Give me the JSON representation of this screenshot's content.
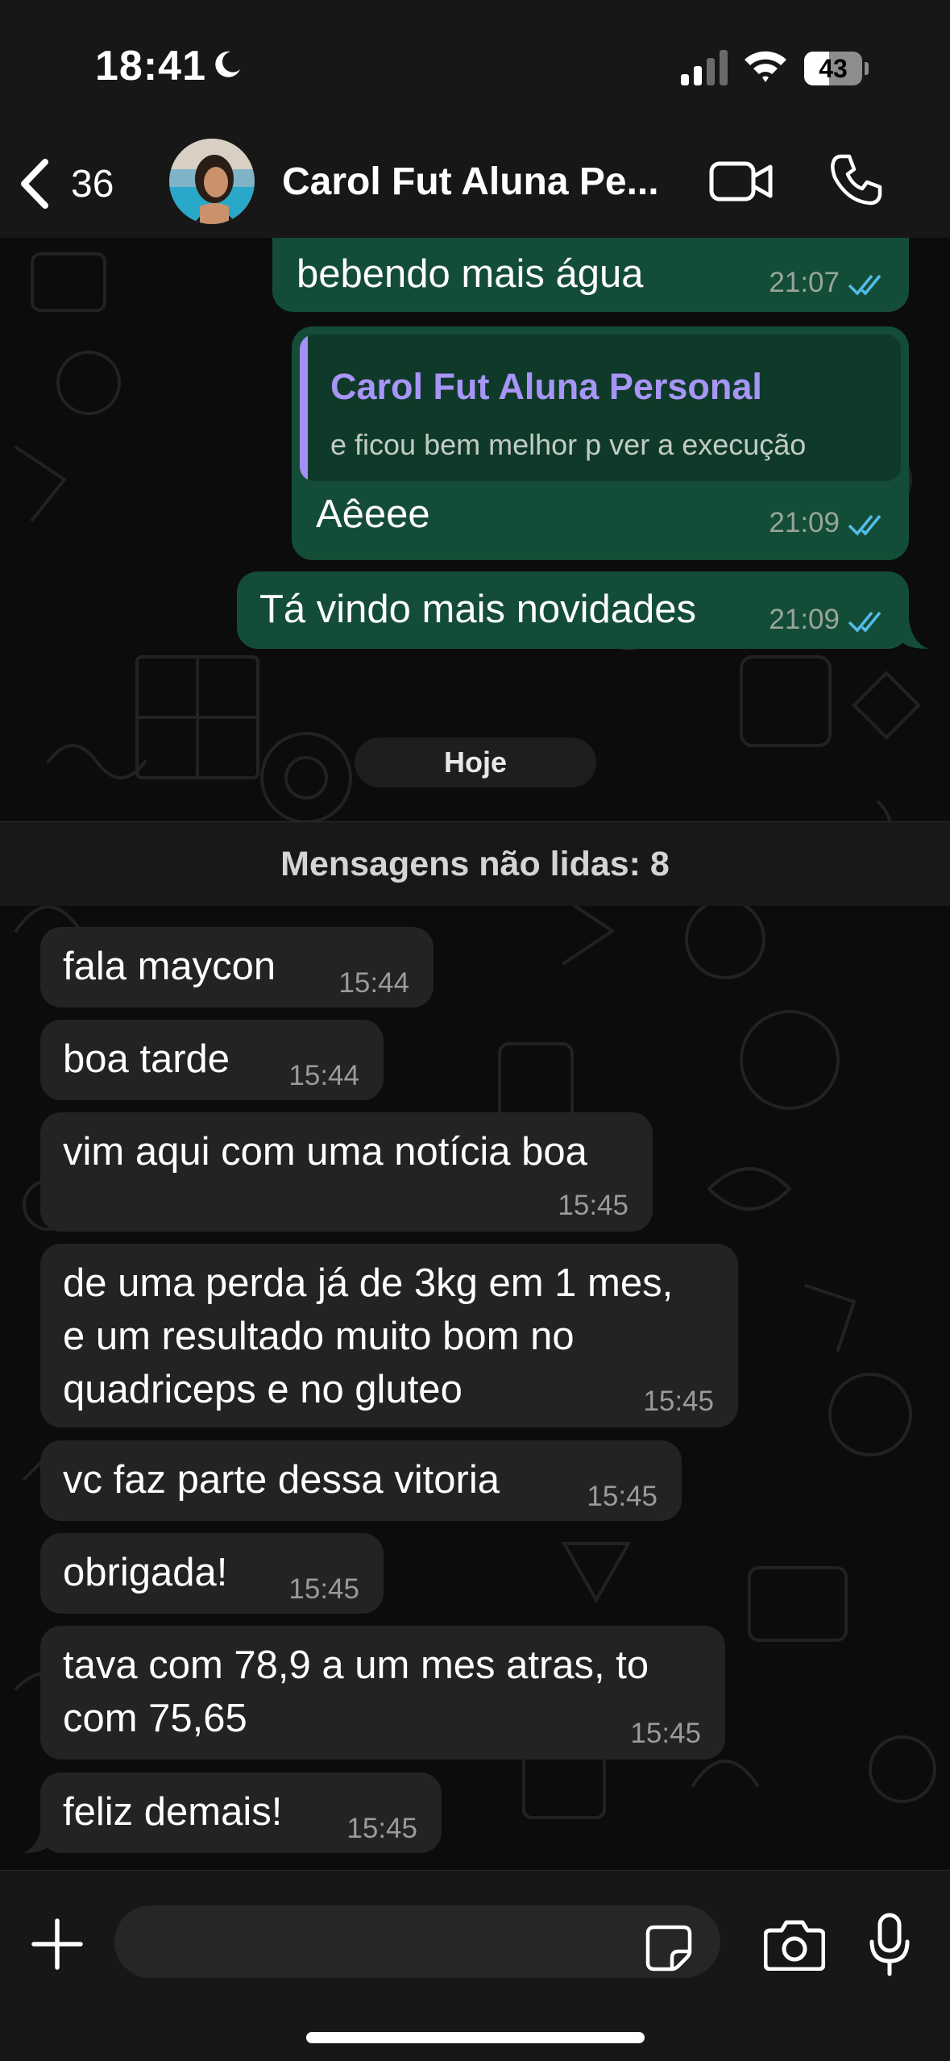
{
  "status_bar": {
    "time": "18:41",
    "battery": "43",
    "battery_level": 0.43
  },
  "header": {
    "back_count": "36",
    "title": "Carol Fut Aluna Pe...",
    "icons": {
      "back": "chevron-left-icon",
      "video": "video-camera-icon",
      "call": "phone-icon"
    }
  },
  "messages_before": [
    {
      "direction": "out",
      "text": "bebendo mais água",
      "time": "21:07",
      "status": "read"
    },
    {
      "direction": "out",
      "quote_author": "Carol Fut Aluna Personal",
      "quote_text": "e ficou bem melhor p ver a execução",
      "text": "Aêeee",
      "time": "21:09",
      "status": "read"
    },
    {
      "direction": "out",
      "text": "Tá vindo mais novidades",
      "time": "21:09",
      "status": "read"
    }
  ],
  "date_separator": "Hoje",
  "unread_banner": "Mensagens não lidas: 8",
  "messages_today": [
    {
      "direction": "in",
      "lines": [
        "fala maycon"
      ],
      "time": "15:44"
    },
    {
      "direction": "in",
      "lines": [
        "boa tarde"
      ],
      "time": "15:44"
    },
    {
      "direction": "in",
      "lines": [
        "vim aqui com uma notícia boa"
      ],
      "time": "15:45"
    },
    {
      "direction": "in",
      "lines": [
        "de uma perda já de 3kg em 1 mes,",
        "e um resultado muito bom no",
        "quadriceps e no gluteo"
      ],
      "time": "15:45"
    },
    {
      "direction": "in",
      "lines": [
        "vc faz parte dessa vitoria"
      ],
      "time": "15:45"
    },
    {
      "direction": "in",
      "lines": [
        "obrigada!"
      ],
      "time": "15:45"
    },
    {
      "direction": "in",
      "lines": [
        "tava com 78,9 a um mes atras, to",
        "com 75,65"
      ],
      "time": "15:45"
    },
    {
      "direction": "in",
      "lines": [
        "feliz demais!"
      ],
      "time": "15:45"
    }
  ],
  "input_bar": {
    "placeholder": "",
    "icons": {
      "add": "plus-icon",
      "sticker": "sticker-icon",
      "camera": "camera-icon",
      "mic": "microphone-icon"
    }
  },
  "colors": {
    "outgoing_bubble": "#144d37",
    "incoming_bubble": "#232323",
    "read_ticks": "#53bdeb",
    "quote_author": "#a795f7",
    "background": "#0c0c0c"
  }
}
